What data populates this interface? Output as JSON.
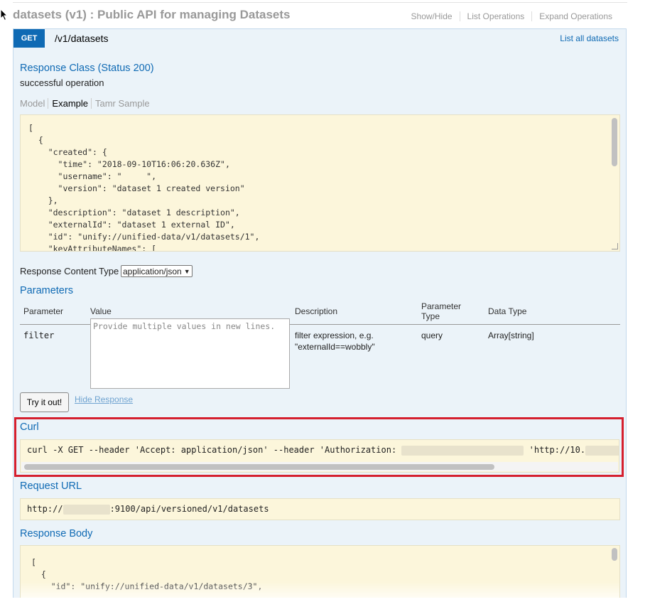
{
  "resource": {
    "title": "datasets (v1) : Public API for managing Datasets",
    "links": [
      "Show/Hide",
      "List Operations",
      "Expand Operations"
    ]
  },
  "operation": {
    "method": "GET",
    "path": "/v1/datasets",
    "summary": "List all datasets"
  },
  "response_class": {
    "heading": "Response Class (Status 200)",
    "description": "successful operation",
    "tabs": [
      "Model",
      "Example",
      "Tamr Sample"
    ],
    "active_tab": "Example",
    "example_lines": [
      "[",
      "  {",
      "    \"created\": {",
      "      \"time\": \"2018-09-10T16:06:20.636Z\",",
      "      \"username\": \"     \",",
      "      \"version\": \"dataset 1 created version\"",
      "    },",
      "    \"description\": \"dataset 1 description\",",
      "    \"externalId\": \"dataset 1 external ID\",",
      "    \"id\": \"unify://unified-data/v1/datasets/1\",",
      "    \"keyAttributeNames\": ["
    ]
  },
  "response_content_type": {
    "label": "Response Content Type",
    "selected": "application/json"
  },
  "parameters": {
    "heading": "Parameters",
    "columns": [
      "Parameter",
      "Value",
      "Description",
      "Parameter Type",
      "Data Type"
    ],
    "rows": [
      {
        "name": "filter",
        "placeholder": "Provide multiple values in new lines.",
        "description_line1": "filter expression, e.g.",
        "description_line2": "\"externalId==wobbly\"",
        "param_type": "query",
        "data_type": "Array[string]"
      }
    ]
  },
  "actions": {
    "try_label": "Try it out!",
    "hide_label": "Hide Response"
  },
  "curl": {
    "heading": "Curl",
    "part1": "curl -X GET --header 'Accept: application/json' --header 'Authorization: ",
    "part2": " 'http://10."
  },
  "request_url": {
    "heading": "Request URL",
    "prefix": "http://",
    "suffix": ":9100/api/versioned/v1/datasets"
  },
  "response_body": {
    "heading": "Response Body",
    "lines": [
      "[",
      "  {",
      "    \"id\": \"unify://unified-data/v1/datasets/3\","
    ]
  },
  "colors": {
    "accent": "#0f6ab4",
    "operation_bg": "#ebf3f9",
    "code_bg": "#fcf6db",
    "highlight": "#d51f2e"
  }
}
